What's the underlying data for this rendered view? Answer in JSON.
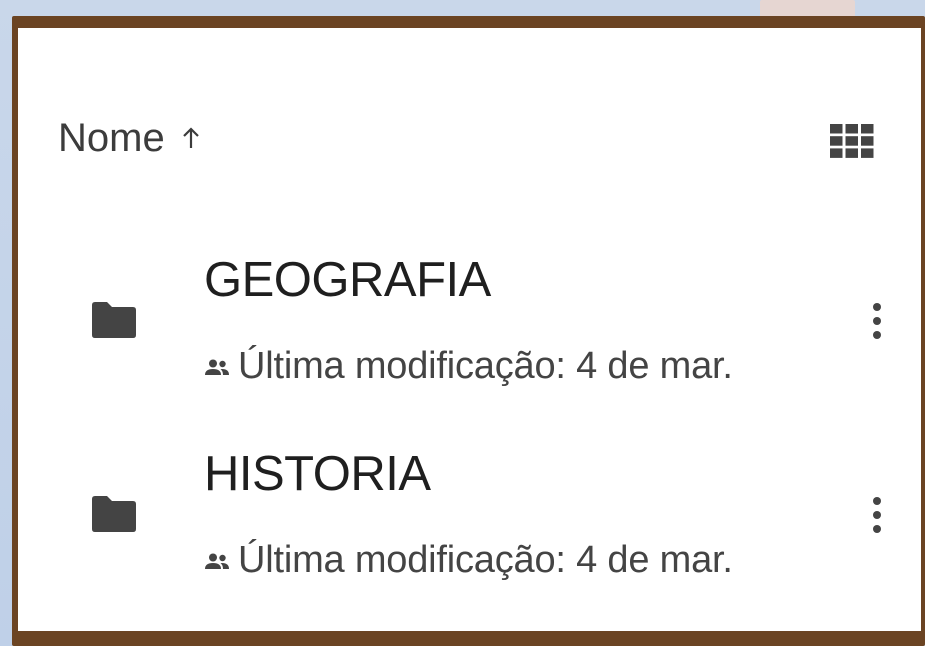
{
  "header": {
    "sort_label": "Nome",
    "sort_direction_icon": "arrow-up-icon",
    "view_toggle_icon": "grid-view-icon"
  },
  "files": [
    {
      "name": "GEOGRAFIA",
      "icon": "folder-icon",
      "shared_icon": "people-icon",
      "meta": "Última modificação: 4 de mar."
    },
    {
      "name": "HISTORIA",
      "icon": "folder-icon",
      "shared_icon": "people-icon",
      "meta": "Última modificação: 4 de mar."
    }
  ],
  "colors": {
    "frame": "#6b4423",
    "panel": "#ffffff",
    "text_primary": "#1f1f1f",
    "text_secondary": "#444444",
    "icon": "#444444",
    "background": "#c9d7ea"
  }
}
